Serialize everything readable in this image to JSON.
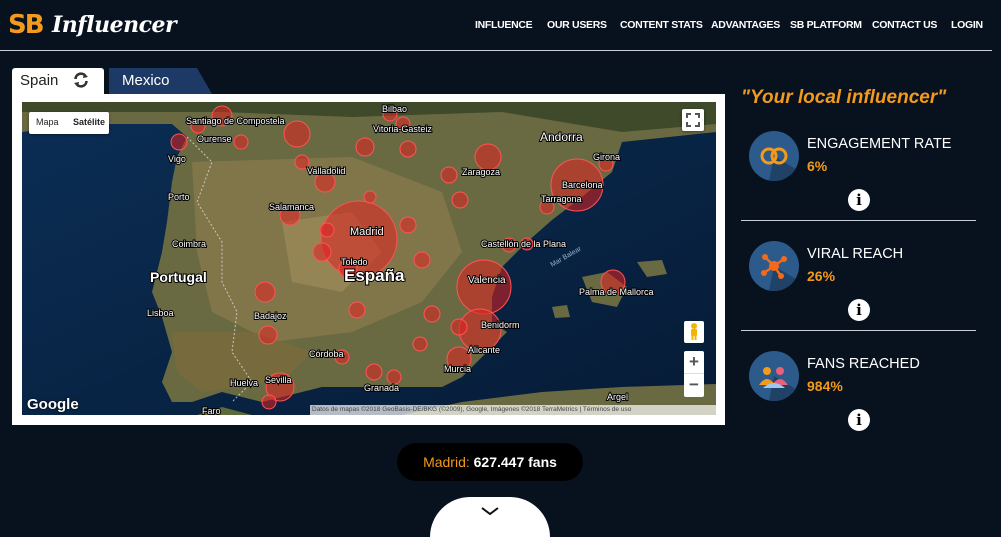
{
  "header": {
    "logo_mark": "SB",
    "logo_text": "Influencer",
    "menu": [
      "INFLUENCE",
      "OUR USERS",
      "CONTENT STATS",
      "ADVANTAGES",
      "SB PLATFORM",
      "CONTACT US",
      "LOGIN"
    ]
  },
  "tabs": [
    {
      "label": "Spain",
      "active": true,
      "icon": "refresh-icon"
    },
    {
      "label": "Mexico",
      "active": false
    }
  ],
  "map": {
    "type_buttons": [
      "Mapa",
      "Satélite"
    ],
    "selected_type": "Satélite",
    "labels": {
      "country_main": "España",
      "portugal": "Portugal",
      "andorra": "Andorra",
      "sea": "Mar Balear",
      "cities": [
        "Santiago de Compostela",
        "Ourense",
        "Vigo",
        "Porto",
        "Coimbra",
        "Lisboa",
        "Badajoz",
        "Sevilla",
        "Huelva",
        "Faro",
        "Córdoba",
        "Granada",
        "Salamanca",
        "Valladolid",
        "Bilbao",
        "Vitoria-Gasteiz",
        "Zaragoza",
        "Girona",
        "Barcelona",
        "Tarragona",
        "Madrid",
        "Toledo",
        "Castellón de la Plana",
        "Valencia",
        "Benidorm",
        "Alicante",
        "Murcia",
        "Palma de Mallorca",
        "Argel"
      ]
    },
    "logo": "Google",
    "attribution": "Datos de mapas ©2018 GeoBasis-DE/BKG (©2009), Google, Imágenes ©2018 TerraMetrics | Términos de uso",
    "controls": {
      "zoom_in": "+",
      "zoom_out": "−"
    }
  },
  "fans_bar": {
    "city": "Madrid:",
    "count": "627.447 fans"
  },
  "sidebar": {
    "title": "\"Your local influencer\"",
    "stats": [
      {
        "name": "ENGAGEMENT RATE",
        "value": "6%",
        "icon": "rings-icon"
      },
      {
        "name": "VIRAL REACH",
        "value": "26%",
        "icon": "network-icon"
      },
      {
        "name": "FANS REACHED",
        "value": "984%",
        "icon": "people-icon"
      }
    ],
    "info_label": "i"
  },
  "colors": {
    "accent": "#f39a1c",
    "background": "#08121f",
    "marker": "#e02020",
    "icon_bg": "#2c5a8a"
  }
}
